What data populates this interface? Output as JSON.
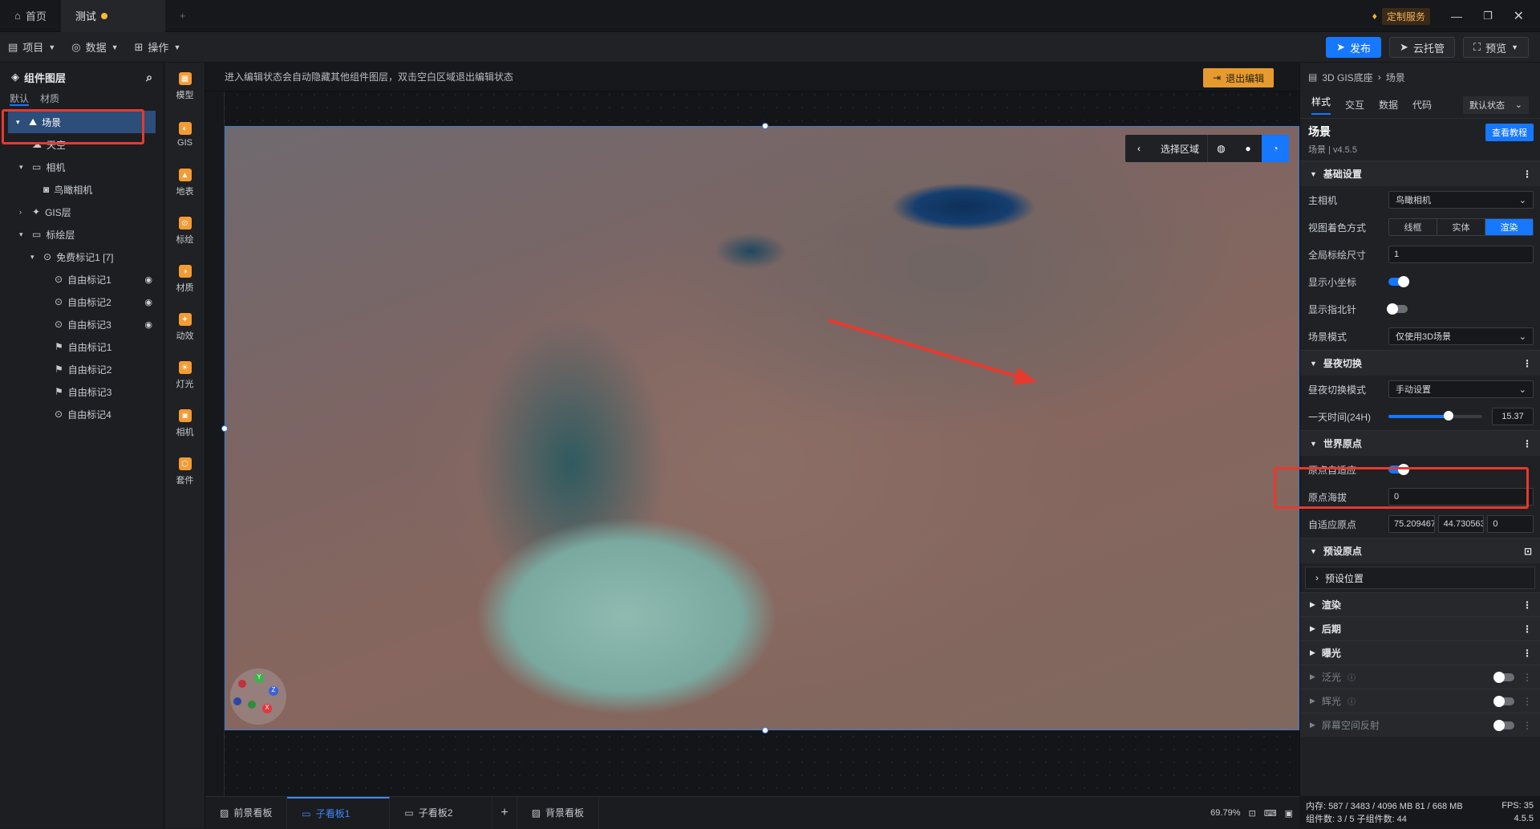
{
  "titlebar": {
    "tabs": [
      {
        "label": "首页"
      },
      {
        "label": "测试"
      }
    ],
    "add_tab": "+",
    "service_label": "定制服务"
  },
  "toolbar": {
    "menus": [
      "项目",
      "数据",
      "操作"
    ],
    "publish": "发布",
    "cloud": "云托管",
    "preview": "预览"
  },
  "left": {
    "title": "组件图层",
    "tabs": [
      "默认",
      "材质"
    ],
    "tree": [
      {
        "label": "场景",
        "indent": 0,
        "icon": "scene-icon",
        "arrow": "▾"
      },
      {
        "label": "天空",
        "indent": 1,
        "icon": "sky-icon",
        "arrow": ""
      },
      {
        "label": "相机",
        "indent": 1,
        "icon": "folder-icon",
        "arrow": "▾"
      },
      {
        "label": "鸟瞰相机",
        "indent": 2,
        "icon": "camera-icon",
        "arrow": ""
      },
      {
        "label": "GIS层",
        "indent": 1,
        "icon": "gis-icon",
        "arrow": "›"
      },
      {
        "label": "标绘层",
        "indent": 1,
        "icon": "folder-icon",
        "arrow": "▾"
      },
      {
        "label": "免费标记1 [7]",
        "indent": 2,
        "icon": "marker-icon",
        "arrow": "▾"
      },
      {
        "label": "自由标记1",
        "indent": 3,
        "icon": "marker-icon",
        "arrow": "",
        "eye": true
      },
      {
        "label": "自由标记2",
        "indent": 3,
        "icon": "marker-icon",
        "arrow": "",
        "eye": true
      },
      {
        "label": "自由标记3",
        "indent": 3,
        "icon": "marker-icon",
        "arrow": "",
        "eye": true
      },
      {
        "label": "自由标记1",
        "indent": 3,
        "icon": "pin-icon",
        "arrow": ""
      },
      {
        "label": "自由标记2",
        "indent": 3,
        "icon": "pin-icon",
        "arrow": ""
      },
      {
        "label": "自由标记3",
        "indent": 3,
        "icon": "pin-icon",
        "arrow": ""
      },
      {
        "label": "自由标记4",
        "indent": 3,
        "icon": "marker-icon",
        "arrow": ""
      }
    ]
  },
  "iconbar": [
    "模型",
    "GIS",
    "地表",
    "标绘",
    "材质",
    "动效",
    "灯光",
    "相机",
    "套件"
  ],
  "canvas": {
    "hint": "进入编辑状态会自动隐藏其他组件图层，双击空白区域退出编辑状态",
    "exit": "退出编辑",
    "select_area": "选择区域",
    "axes": {
      "y": "Y",
      "z": "Z",
      "x": "X"
    }
  },
  "bottom": {
    "tabs": [
      "前景看板",
      "子看板1",
      "子看板2",
      "背景看板"
    ],
    "add": "+",
    "zoom": "69.79%"
  },
  "right": {
    "crumb": [
      "3D GIS底座",
      "场景"
    ],
    "tabs": [
      "样式",
      "交互",
      "数据",
      "代码"
    ],
    "state": "默认状态",
    "comp_name": "场景",
    "comp_version": "场景 | v4.5.5",
    "tutorial": "查看教程",
    "basic": {
      "title": "基础设置",
      "camera_label": "主相机",
      "camera_value": "鸟瞰相机",
      "shading_label": "视图着色方式",
      "shading_options": [
        "线框",
        "实体",
        "渲染"
      ],
      "marker_size_label": "全局标绘尺寸",
      "marker_size_value": "1",
      "show_axes_label": "显示小坐标",
      "show_compass_label": "显示指北针",
      "scene_mode_label": "场景模式",
      "scene_mode_value": "仅使用3D场景"
    },
    "daynight": {
      "title": "昼夜切换",
      "mode_label": "昼夜切换模式",
      "mode_value": "手动设置",
      "time_label": "一天时间(24H)",
      "time_value": "15.37",
      "time_fraction": 0.64
    },
    "origin": {
      "title": "世界原点",
      "adaptive_label": "原点自适应",
      "altitude_label": "原点海拔",
      "altitude_value": "0",
      "adaptive_origin_label": "自适应原点",
      "adaptive_origin_values": [
        "75.209467",
        "44.730563",
        "0"
      ]
    },
    "preset": {
      "title": "预设原点",
      "position": "预设位置"
    },
    "collapsed": [
      "渲染",
      "后期",
      "曝光"
    ],
    "toggles": [
      "泛光",
      "辉光",
      "屏幕空间反射"
    ]
  },
  "status": {
    "memory": "内存: 587 / 3483 / 4096 MB 81 / 668 MB",
    "fps": "FPS: 35",
    "components": "组件数: 3 / 5   子组件数: 44",
    "version": "4.5.5"
  }
}
